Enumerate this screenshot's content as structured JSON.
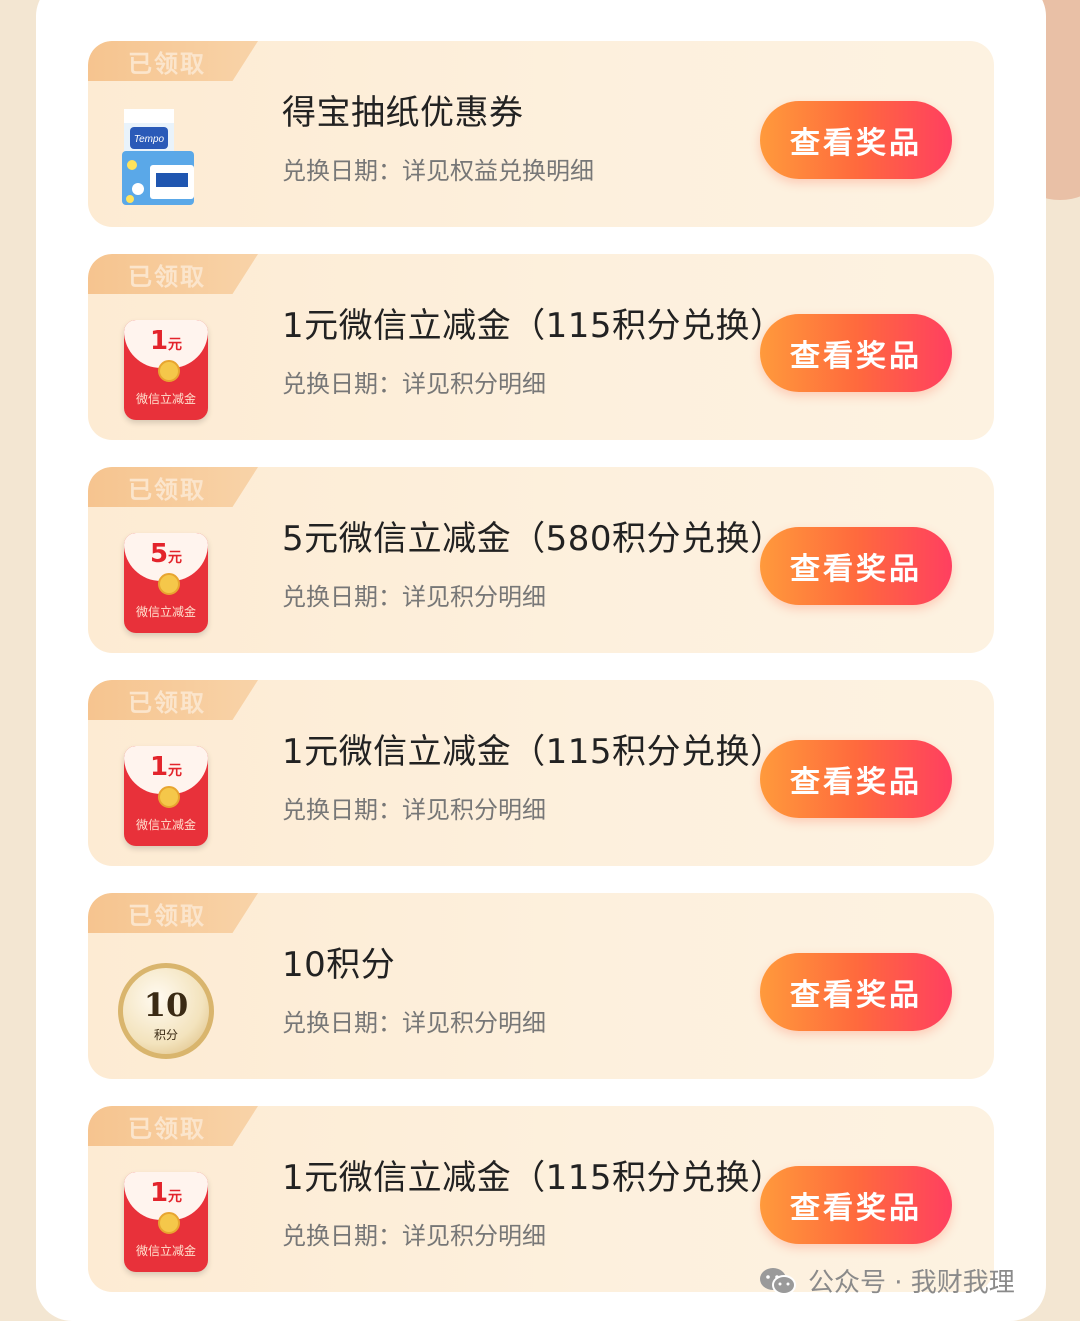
{
  "tag_label": "已领取",
  "button_label": "查看奖品",
  "items": [
    {
      "title": "得宝抽纸优惠券",
      "date": "兑换日期：详见权益兑换明细",
      "thumb": "tissue-product-image",
      "brand": "Tempo"
    },
    {
      "title": "1元微信立减金（115积分兑换）",
      "date": "兑换日期：详见积分明细",
      "thumb": "red-envelope-icon",
      "amount": "1",
      "unit": "元",
      "envelope_label": "微信立减金"
    },
    {
      "title": "5元微信立减金（580积分兑换）",
      "date": "兑换日期：详见积分明细",
      "thumb": "red-envelope-icon",
      "amount": "5",
      "unit": "元",
      "envelope_label": "微信立减金"
    },
    {
      "title": "1元微信立减金（115积分兑换）",
      "date": "兑换日期：详见积分明细",
      "thumb": "red-envelope-icon",
      "amount": "1",
      "unit": "元",
      "envelope_label": "微信立减金"
    },
    {
      "title": "10积分",
      "date": "兑换日期：详见积分明细",
      "thumb": "points-coin-icon",
      "coin_value": "10",
      "coin_label": "积分"
    },
    {
      "title": "1元微信立减金（115积分兑换）",
      "date": "兑换日期：详见积分明细",
      "thumb": "red-envelope-icon",
      "amount": "1",
      "unit": "元",
      "envelope_label": "微信立减金"
    }
  ],
  "watermark": {
    "text": "公众号 · 我财我理",
    "icon": "wechat-icon"
  },
  "colors": {
    "button_start": "#ff9a3c",
    "button_end": "#ff3f60",
    "card_bg": "#fdebd3",
    "tag_bg": "#f6c48f"
  }
}
